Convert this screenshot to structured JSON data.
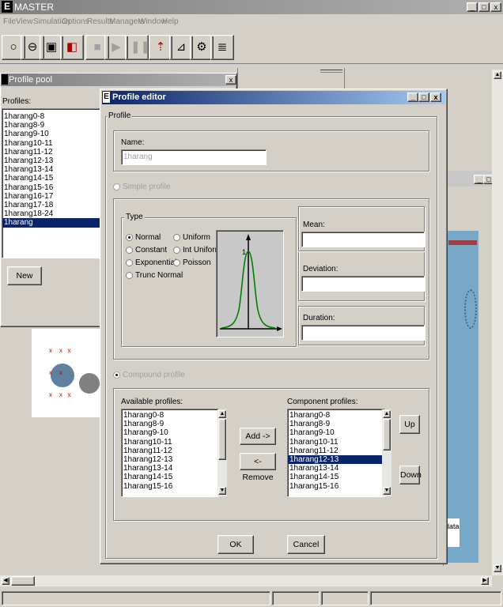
{
  "app": {
    "title": "MASTER",
    "logo_letter": "E"
  },
  "menu": [
    "File",
    "View",
    "Simulation",
    "Options",
    "Results",
    "Managers",
    "Window",
    "Help"
  ],
  "profile_pool": {
    "title": "Profile pool",
    "profiles_label": "Profiles:",
    "items": [
      "1harang0-8",
      "1harang8-9",
      "1harang9-10",
      "1harang10-11",
      "1harang11-12",
      "1harang12-13",
      "1harang13-14",
      "1harang14-15",
      "1harang15-16",
      "1harang16-17",
      "1harang17-18",
      "1harang18-24",
      "1harang"
    ],
    "selected_index": 12,
    "new_label": "New"
  },
  "editor": {
    "title": "Profile editor",
    "profile_group": "Profile",
    "name_label": "Name:",
    "name_value": "1harang",
    "simple_profile_label": "Simple profile",
    "type_group": "Type",
    "types_left": [
      "Normal",
      "Constant",
      "Exponential",
      "Trunc Normal"
    ],
    "types_right": [
      "Uniform",
      "Int Uniform",
      "Poisson"
    ],
    "selected_type": "Normal",
    "graph_peak_label": "1",
    "mean_label": "Mean:",
    "deviation_label": "Deviation:",
    "duration_label": "Duration:",
    "compound_profile_label": "Compound profile",
    "available_label": "Available profiles:",
    "available": [
      "1harang0-8",
      "1harang8-9",
      "1harang9-10",
      "1harang10-11",
      "1harang11-12",
      "1harang12-13",
      "1harang13-14",
      "1harang14-15",
      "1harang15-16"
    ],
    "component_label": "Component profiles:",
    "component": [
      "1harang0-8",
      "1harang8-9",
      "1harang9-10",
      "1harang10-11",
      "1harang11-12",
      "1harang12-13",
      "1harang13-14",
      "1harang14-15",
      "1harang15-16"
    ],
    "component_selected_index": 5,
    "add_label": "Add ->",
    "remove_label": "<- Remove",
    "up_label": "Up",
    "down_label": "Down",
    "ok_label": "OK",
    "cancel_label": "Cancel"
  },
  "background": {
    "side_text": "data"
  },
  "colors": {
    "selection": "#0a246a",
    "curve": "#008000",
    "map_bg": "#78a8c8"
  }
}
